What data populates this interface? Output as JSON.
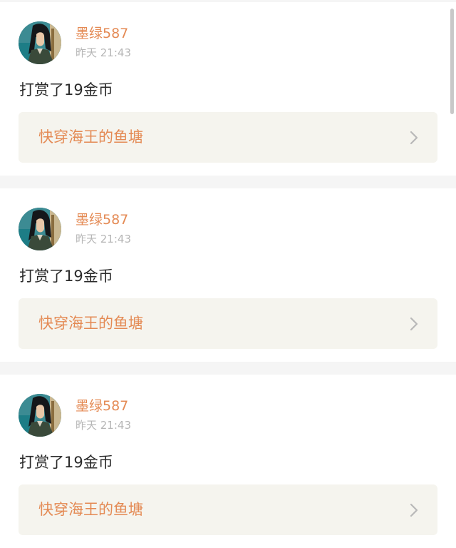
{
  "feed": {
    "items": [
      {
        "avatar_icon": "user-avatar-icon",
        "username": "墨绿587",
        "timestamp": "昨天 21:43",
        "reward_text": "打赏了19金币",
        "book_title": "快穿海王的鱼塘",
        "chevron_icon": "chevron-right-icon"
      },
      {
        "avatar_icon": "user-avatar-icon",
        "username": "墨绿587",
        "timestamp": "昨天 21:43",
        "reward_text": "打赏了19金币",
        "book_title": "快穿海王的鱼塘",
        "chevron_icon": "chevron-right-icon"
      },
      {
        "avatar_icon": "user-avatar-icon",
        "username": "墨绿587",
        "timestamp": "昨天 21:43",
        "reward_text": "打赏了19金币",
        "book_title": "快穿海王的鱼塘",
        "chevron_icon": "chevron-right-icon"
      }
    ]
  },
  "colors": {
    "accent": "#e48a54",
    "timestamp": "#b6b6b6",
    "body_text": "#2a2a2a",
    "link_background": "#f5f4ee",
    "page_background": "#f5f5f5"
  }
}
